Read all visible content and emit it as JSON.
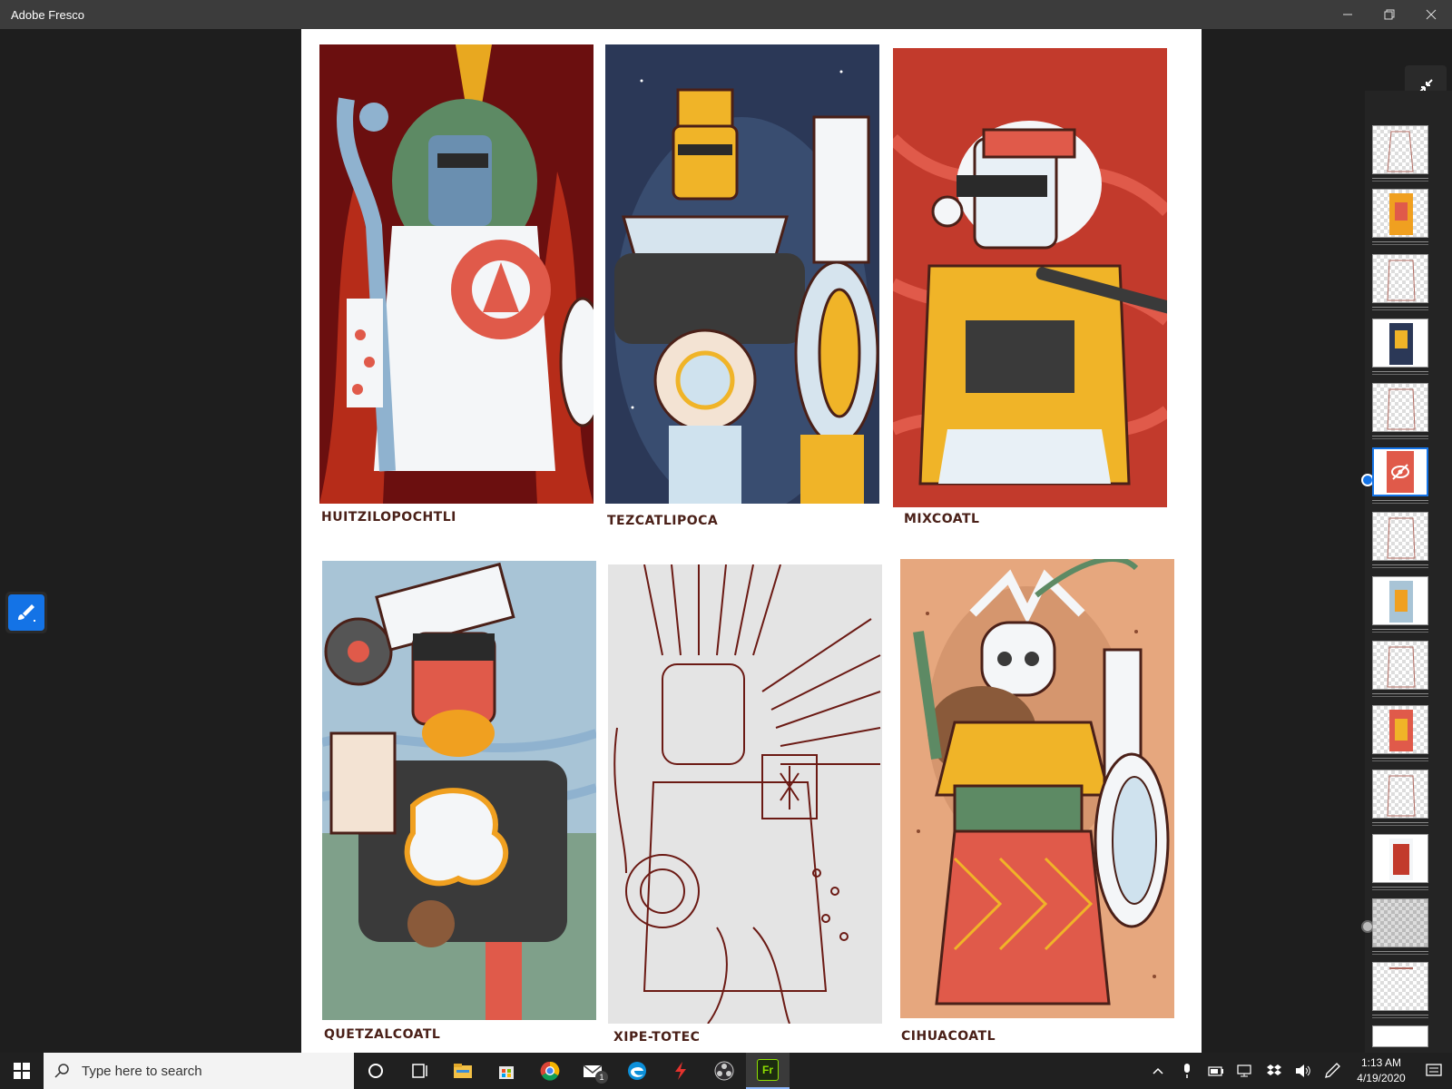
{
  "window": {
    "title": "Adobe Fresco",
    "minimize_icon": "minimize-icon",
    "maximize_icon": "restore-icon",
    "close_icon": "close-icon"
  },
  "artboard": {
    "panels": [
      {
        "label": "HUITZILOPOCHTLI",
        "bg": "#6b0f0f"
      },
      {
        "label": "TEZCATLIPOCA",
        "bg": "#2b3857"
      },
      {
        "label": "MIXCOATL",
        "bg": "#c23a2c"
      },
      {
        "label": "QUETZALCOATL",
        "bg": "#a8c4d6"
      },
      {
        "label": "XIPE-TOTEC",
        "bg": "#e4e4e4"
      },
      {
        "label": "CIHUACOATL",
        "bg": "#e6a77e"
      }
    ]
  },
  "toolbar": {
    "active_tool_icon": "brush-icon",
    "collapse_icon": "collapse-arrows-icon"
  },
  "layers": {
    "hidden_icon": "eye-hidden-icon",
    "selected_index": 5
  },
  "taskbar": {
    "search_placeholder": "Type here to search",
    "apps": [
      "cortana-icon",
      "task-view-icon",
      "file-explorer-icon",
      "store-icon",
      "chrome-icon",
      "mail-icon",
      "edge-icon",
      "app-red-icon",
      "obs-icon",
      "fresco-icon"
    ],
    "mail_badge": "1",
    "fresco_label": "Fr",
    "time": "1:13 AM",
    "date": "4/19/2020"
  },
  "colors": {
    "accent": "#1473e6",
    "titlebar": "#3c3c3c",
    "workspace": "#1e1e1e",
    "label_ink": "#4a2018"
  }
}
